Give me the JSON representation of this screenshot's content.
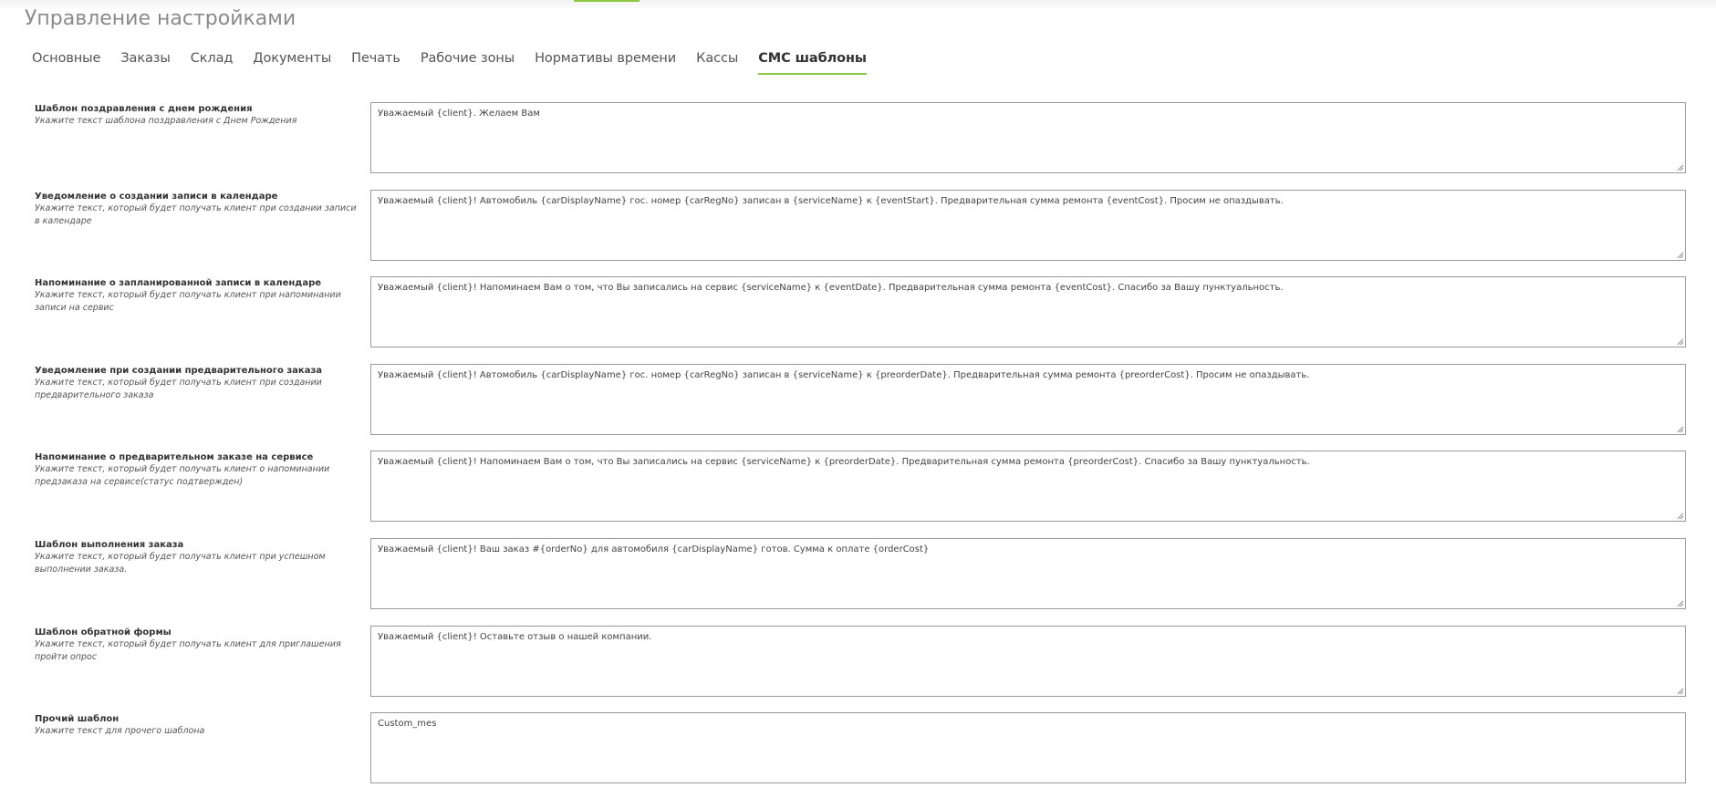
{
  "page": {
    "title": "Управление настройками"
  },
  "tabs": [
    {
      "label": "Основные",
      "active": false
    },
    {
      "label": "Заказы",
      "active": false
    },
    {
      "label": "Склад",
      "active": false
    },
    {
      "label": "Документы",
      "active": false
    },
    {
      "label": "Печать",
      "active": false
    },
    {
      "label": "Рабочие зоны",
      "active": false
    },
    {
      "label": "Нормативы времени",
      "active": false
    },
    {
      "label": "Кассы",
      "active": false
    },
    {
      "label": "СМС шаблоны",
      "active": true
    }
  ],
  "templates": [
    {
      "title": "Шаблон поздравления с днем рождения",
      "hint": "Укажите текст шаблона поздравления с Днем Рождения",
      "value": "Уважаемый {client}. Желаем Вам"
    },
    {
      "title": "Уведомление о создании записи в календаре",
      "hint": "Укажите текст, который будет получать клиент при создании записи в календаре",
      "value": "Уважаемый {client}! Автомобиль {carDisplayName} гос. номер {carRegNo} записан в {serviceName} к {eventStart}. Предварительная сумма ремонта {eventCost}. Просим не опаздывать."
    },
    {
      "title": "Напоминание о запланированной записи в календаре",
      "hint": "Укажите текст, который будет получать клиент при напоминании записи на сервис",
      "value": "Уважаемый {client}! Напоминаем Вам о том, что Вы записались на сервис {serviceName} к {eventDate}. Предварительная сумма ремонта {eventCost}. Спасибо за Вашу пунктуальность."
    },
    {
      "title": "Уведомление при создании предварительного заказа",
      "hint": "Укажите текст, который будет получать клиент при создании предварительного заказа",
      "value": "Уважаемый {client}! Автомобиль {carDisplayName} гос. номер {carRegNo} записан в {serviceName} к {preorderDate}. Предварительная сумма ремонта {preorderCost}. Просим не опаздывать."
    },
    {
      "title": "Напоминание о предварительном заказе на сервисе",
      "hint": "Укажите текст, который будет получать клиент о напоминании предзаказа на сервисе(статус подтвержден)",
      "value": "Уважаемый {client}! Напоминаем Вам о том, что Вы записались на сервис {serviceName} к {preorderDate}. Предварительная сумма ремонта {preorderCost}. Спасибо за Вашу пунктуальность."
    },
    {
      "title": "Шаблон выполнения заказа",
      "hint": "Укажите текст, который будет получать клиент при успешном выполнении заказа.",
      "value": "Уважаемый {client}! Ваш заказ #{orderNo} для автомобиля {carDisplayName} готов. Сумма к оплате {orderCost}"
    },
    {
      "title": "Шаблон обратной формы",
      "hint": "Укажите текст, который будет получать клиент для приглашения пройти опрос",
      "value": "Уважаемый {client}! Оставьте отзыв о нашей компании."
    },
    {
      "title": "Прочий шаблон",
      "hint": "Укажите текст для прочего шаблона",
      "value": "Custom_mes"
    }
  ],
  "colors": {
    "accent": "#8dc63f",
    "title_gray": "#8a8a8a",
    "border": "#9a9a9a"
  },
  "icons": {
    "resize": "resize-grip-icon"
  }
}
